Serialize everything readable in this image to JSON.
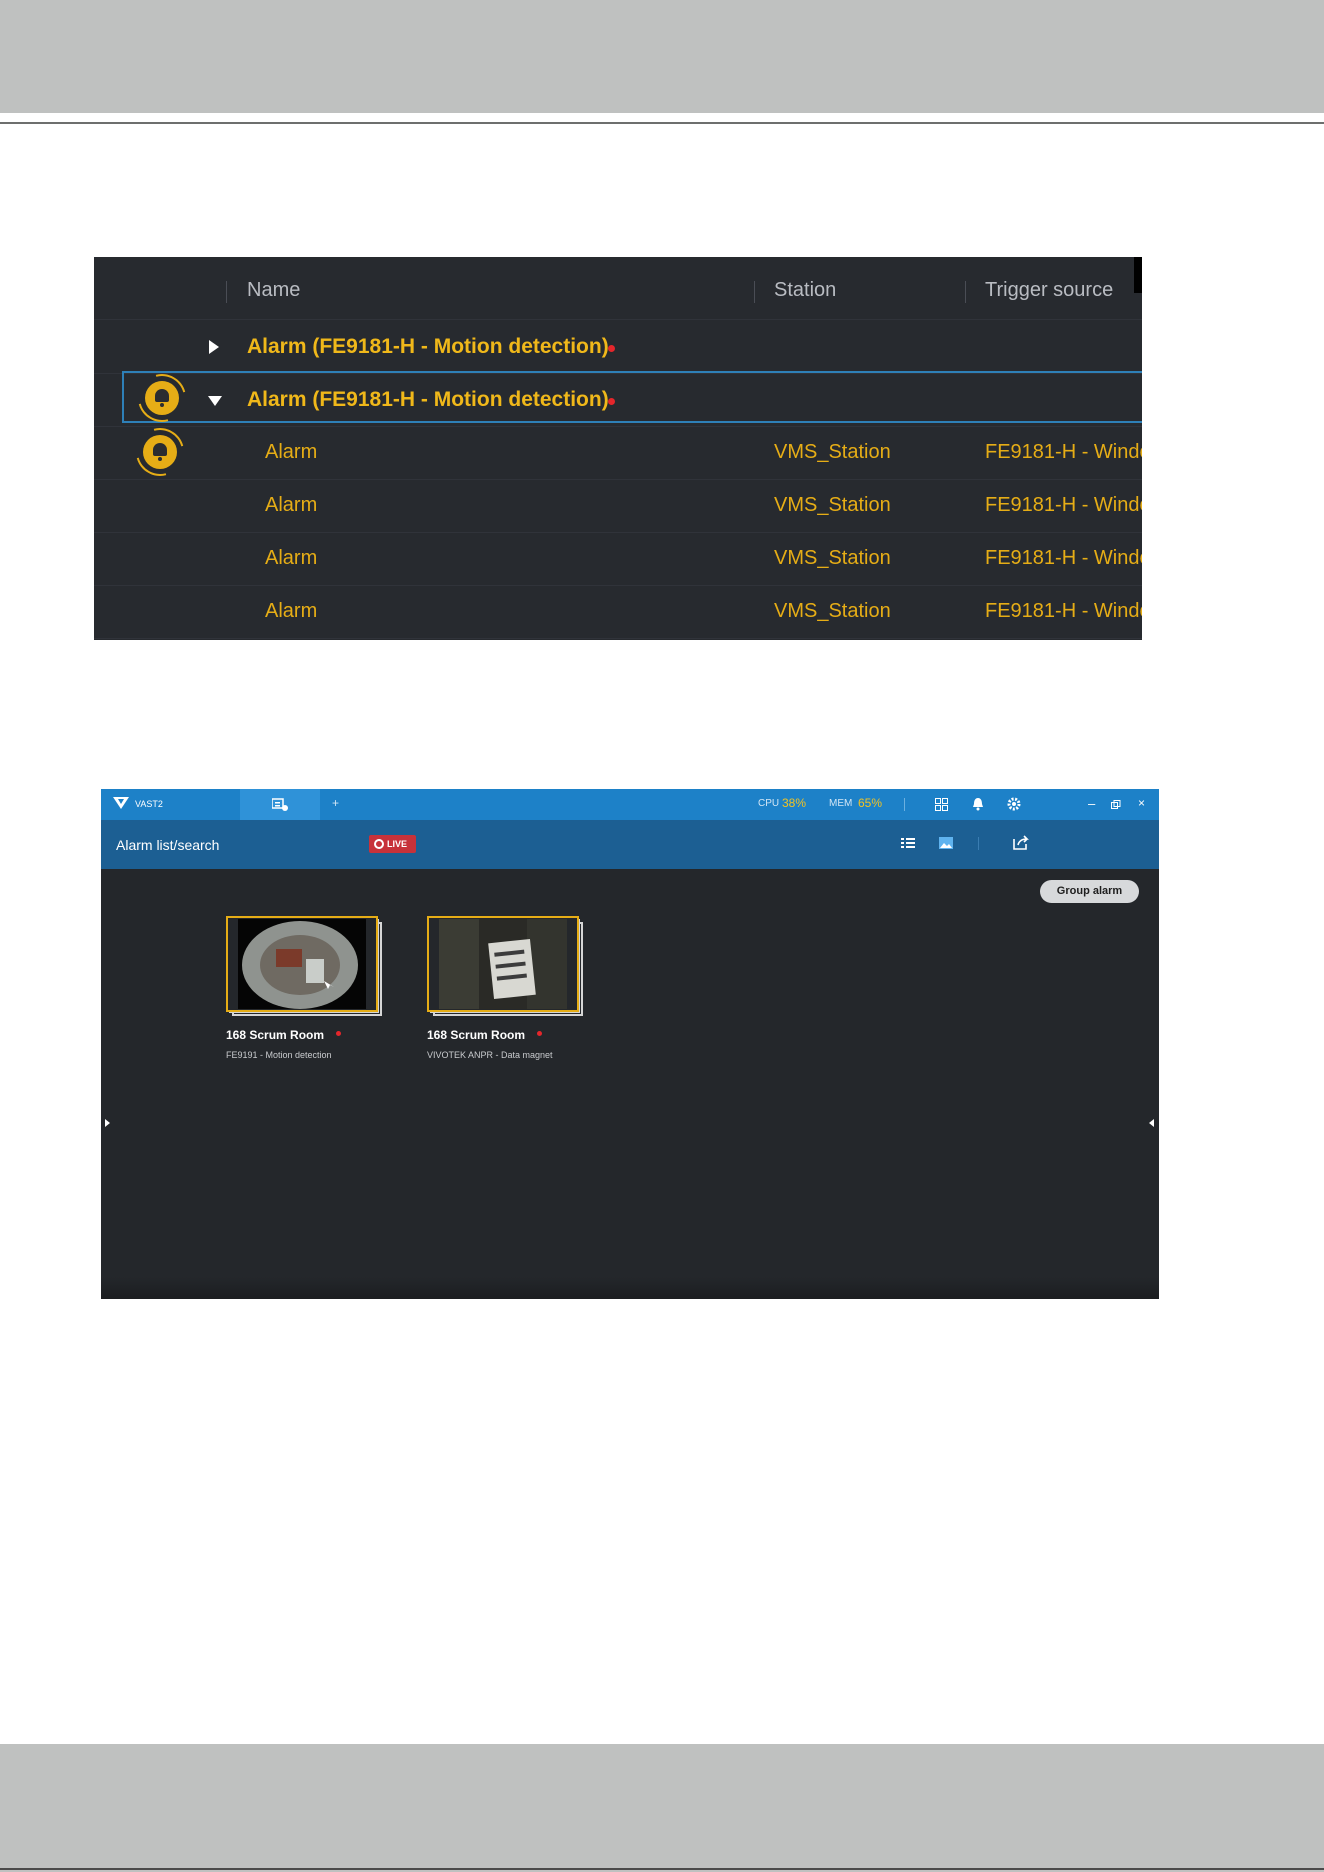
{
  "colors": {
    "page_band": "#bfc1c0",
    "alarm_yellow": "#e6ad16",
    "accent_blue": "#1d81c8",
    "alarm_red": "#e5262b"
  },
  "alarm_list": {
    "columns": [
      "Name",
      "Station",
      "Trigger source"
    ],
    "groups": [
      {
        "label": "Alarm (FE9181-H - Motion detection)",
        "expanded": false
      },
      {
        "label": "Alarm (FE9181-H - Motion detection)",
        "expanded": true
      }
    ],
    "rows": [
      {
        "name": "Alarm",
        "station": "VMS_Station",
        "trigger": "FE9181-H - Windo..."
      },
      {
        "name": "Alarm",
        "station": "VMS_Station",
        "trigger": "FE9181-H - Windo..."
      },
      {
        "name": "Alarm",
        "station": "VMS_Station",
        "trigger": "FE9181-H - Windo..."
      },
      {
        "name": "Alarm",
        "station": "VMS_Station",
        "trigger": "FE9181-H - Windo..."
      }
    ]
  },
  "vast": {
    "app_name": "VAST2",
    "cpu_label": "CPU",
    "cpu_value": "38%",
    "mem_label": "MEM",
    "mem_value": "65%",
    "page_title": "Alarm list/search",
    "live_label": "LIVE",
    "group_button": "Group alarm",
    "cards": [
      {
        "title": "168 Scrum Room",
        "subtitle": "FE9191 - Motion detection"
      },
      {
        "title": "168 Scrum Room",
        "subtitle": "VIVOTEK ANPR - Data magnet"
      }
    ],
    "icons": [
      "logo-icon",
      "alarm-tab-icon",
      "add-tab-icon",
      "layout-icon",
      "bell-icon",
      "settings-icon",
      "minimize-icon",
      "restore-icon",
      "close-icon",
      "list-view-icon",
      "thumbnail-view-icon",
      "export-icon"
    ]
  }
}
